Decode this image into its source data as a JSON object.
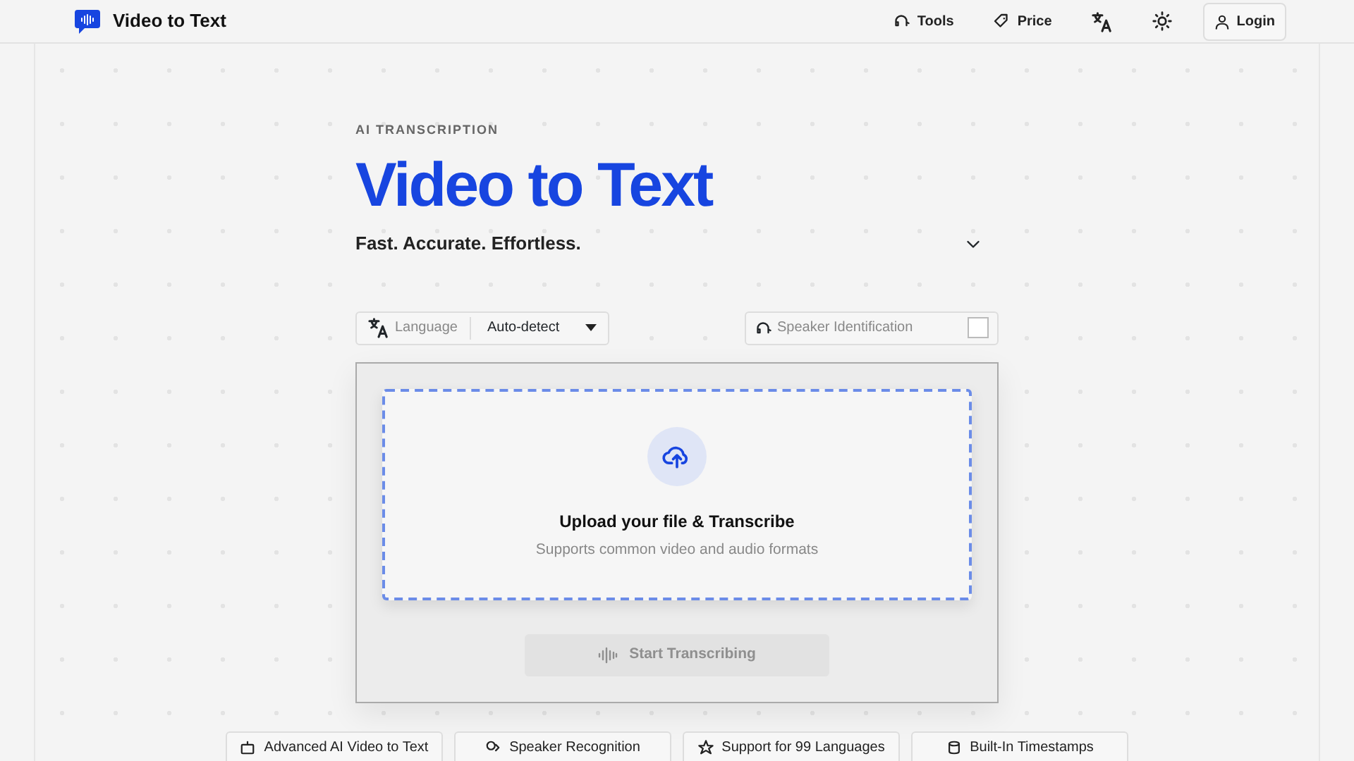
{
  "brand": {
    "title": "Video to Text"
  },
  "nav": [
    {
      "kind": "tools",
      "label": "Tools"
    },
    {
      "kind": "price",
      "label": "Price"
    },
    {
      "kind": "language"
    },
    {
      "kind": "theme"
    },
    {
      "kind": "login",
      "label": "Login"
    }
  ],
  "hero": {
    "eyebrow": "AI TRANSCRIPTION",
    "title": "Video to Text",
    "tagline": "Fast. Accurate. Effortless.",
    "expanded": false
  },
  "options": {
    "language_label": "Language",
    "language_value": "Auto-detect",
    "speaker_label": "Speaker Identification",
    "speaker_checked": false
  },
  "upload": {
    "title": "Upload your file & Transcribe",
    "subtitle": "Supports common video and audio formats"
  },
  "start_button": {
    "label": "Start Transcribing",
    "disabled": true
  },
  "features": [
    {
      "kind": "ai",
      "label": "Advanced AI Video to Text"
    },
    {
      "kind": "speaker",
      "label": "Speaker Recognition"
    },
    {
      "kind": "languages",
      "label": "Support for 99 Languages"
    },
    {
      "kind": "timestamps",
      "label": "Built-In Timestamps"
    }
  ]
}
